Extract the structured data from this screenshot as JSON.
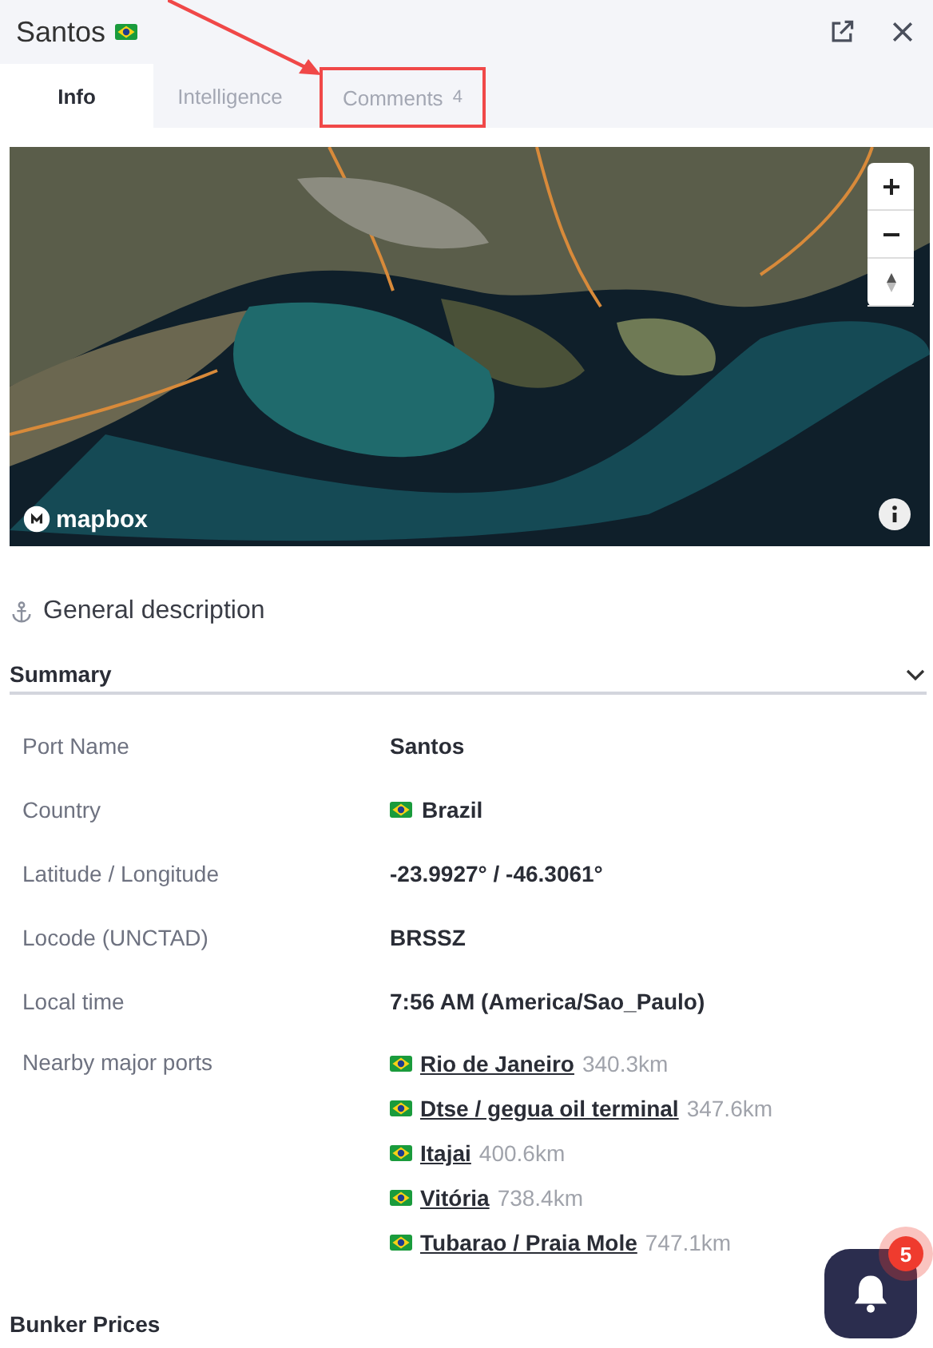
{
  "header": {
    "title": "Santos"
  },
  "tabs": [
    {
      "label": "Info",
      "selected": true,
      "highlighted": false
    },
    {
      "label": "Intelligence",
      "selected": false,
      "highlighted": false
    },
    {
      "label": "Comments",
      "count": "4",
      "selected": false,
      "highlighted": true
    }
  ],
  "map": {
    "kind": "picture",
    "attribution": "mapbox"
  },
  "section": {
    "title": "General description"
  },
  "summary": {
    "title": "Summary",
    "expanded": true,
    "rows": [
      {
        "label": "Port Name",
        "value": "Santos"
      },
      {
        "label": "Country",
        "value": "Brazil",
        "kind": "country"
      },
      {
        "label": "Latitude / Longitude",
        "value": "-23.9927° / -46.3061°"
      },
      {
        "label": "Locode (UNCTAD)",
        "value": "BRSSZ"
      },
      {
        "label": "Local time",
        "value": "7:56 AM (America/Sao_Paulo)"
      }
    ],
    "nearby_label": "Nearby major ports",
    "nearby": [
      {
        "name": "Rio de Janeiro",
        "distance": "340.3km"
      },
      {
        "name": "Dtse / gegua oil terminal",
        "distance": "347.6km"
      },
      {
        "name": "Itajai",
        "distance": "400.6km"
      },
      {
        "name": "Vitória",
        "distance": "738.4km"
      },
      {
        "name": "Tubarao / Praia Mole",
        "distance": "747.1km"
      }
    ]
  },
  "next_section": {
    "title": "Bunker Prices"
  },
  "notifications": {
    "count": "5"
  }
}
